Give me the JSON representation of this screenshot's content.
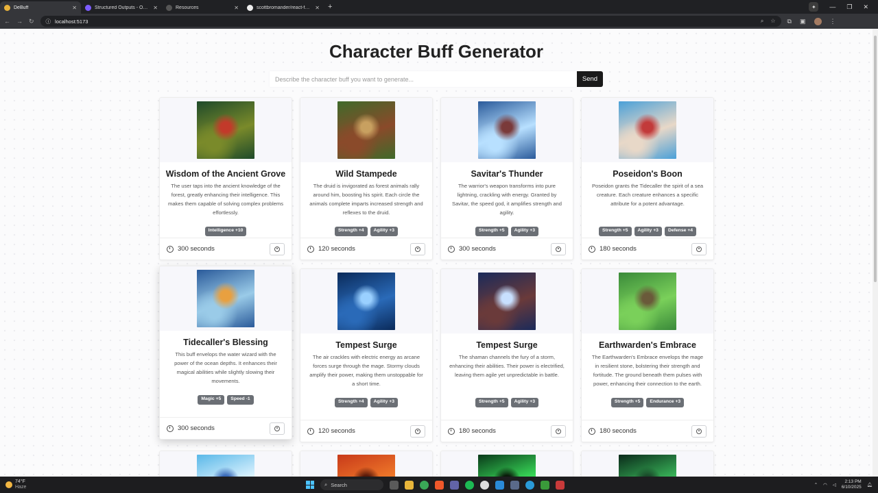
{
  "browser": {
    "tabs": [
      {
        "title": "DeBuff",
        "active": true
      },
      {
        "title": "Structured Outputs - OpenAI API",
        "active": false
      },
      {
        "title": "Resources",
        "active": false
      },
      {
        "title": "scottbromander/react-fastapi-",
        "active": false
      }
    ],
    "url": "localhost:5173"
  },
  "app": {
    "title": "Character Buff Generator",
    "search_placeholder": "Describe the character buff you want to generate...",
    "send_label": "Send"
  },
  "cards": [
    {
      "title": "Wisdom of the Ancient Grove",
      "description": "The user taps into the ancient knowledge of the forest, greatly enhancing their intelligence. This makes them capable of solving complex problems effortlessly.",
      "badges": [
        "Intelligence +10"
      ],
      "duration": "300 seconds",
      "palette": [
        "#1e4a2a",
        "#7a8a2a",
        "#c23a2a"
      ]
    },
    {
      "title": "Wild Stampede",
      "description": "The druid is invigorated as forest animals rally around him, boosting his spirit. Each circle the animals complete imparts increased strength and reflexes to the druid.",
      "badges": [
        "Strength +4",
        "Agility +3"
      ],
      "duration": "120 seconds",
      "palette": [
        "#3f6a2a",
        "#8a4a2a",
        "#c8a060"
      ]
    },
    {
      "title": "Savitar's Thunder",
      "description": "The warrior's weapon transforms into pure lightning, crackling with energy. Granted by Savitar, the speed god, it amplifies strength and agility.",
      "badges": [
        "Strength +5",
        "Agility +3"
      ],
      "duration": "300 seconds",
      "palette": [
        "#2a5a9a",
        "#b8e0ff",
        "#7a3a3a"
      ]
    },
    {
      "title": "Poseidon's Boon",
      "description": "Poseidon grants the Tidecaller the spirit of a sea creature. Each creature enhances a specific attribute for a potent advantage.",
      "badges": [
        "Strength +5",
        "Agility +3",
        "Defense +4"
      ],
      "duration": "180 seconds",
      "palette": [
        "#4aa0d8",
        "#e8d8c8",
        "#c23a3a"
      ]
    },
    {
      "title": "Tidecaller's Blessing",
      "description": "This buff envelops the water wizard with the power of the ocean depths. It enhances their magical abilities while slightly slowing their movements.",
      "badges": [
        "Magic +5",
        "Speed -1"
      ],
      "duration": "300 seconds",
      "palette": [
        "#2a5a9a",
        "#9acbe8",
        "#e8a040"
      ]
    },
    {
      "title": "Tempest Surge",
      "description": "The air crackles with electric energy as arcane forces surge through the mage. Stormy clouds amplify their power, making them unstoppable for a short time.",
      "badges": [
        "Strength +4",
        "Agility +3"
      ],
      "duration": "120 seconds",
      "palette": [
        "#0a2a5a",
        "#2a6ab8",
        "#9ad0ff"
      ]
    },
    {
      "title": "Tempest Surge",
      "description": "The shaman channels the fury of a storm, enhancing their abilities. Their power is electrified, leaving them agile yet unpredictable in battle.",
      "badges": [
        "Strength +5",
        "Agility +3"
      ],
      "duration": "180 seconds",
      "palette": [
        "#1a2a5a",
        "#6a3a3a",
        "#c8e0ff"
      ]
    },
    {
      "title": "Earthwarden's Embrace",
      "description": "The Earthwarden's Embrace envelops the mage in resilient stone, bolstering their strength and fortitude. The ground beneath them pulses with power, enhancing their connection to the earth.",
      "badges": [
        "Strength +5",
        "Endurance +3"
      ],
      "duration": "180 seconds",
      "palette": [
        "#3a8a3a",
        "#7ad05a",
        "#6a5a3a"
      ]
    }
  ],
  "partial_cards": [
    {
      "palette": [
        "#5ab8e8",
        "#e0f4ff",
        "#3a6ab8"
      ]
    },
    {
      "palette": [
        "#c83a1a",
        "#f07a2a",
        "#5a1a0a"
      ]
    },
    {
      "palette": [
        "#0a3a1a",
        "#3ae05a",
        "#0a1a0a"
      ]
    },
    {
      "palette": [
        "#0a2a1a",
        "#3ab85a",
        "#1a4a2a"
      ]
    }
  ],
  "taskbar": {
    "temperature": "74°F",
    "condition": "Haze",
    "search_label": "Search",
    "time": "2:13 PM",
    "date": "6/10/2025"
  }
}
